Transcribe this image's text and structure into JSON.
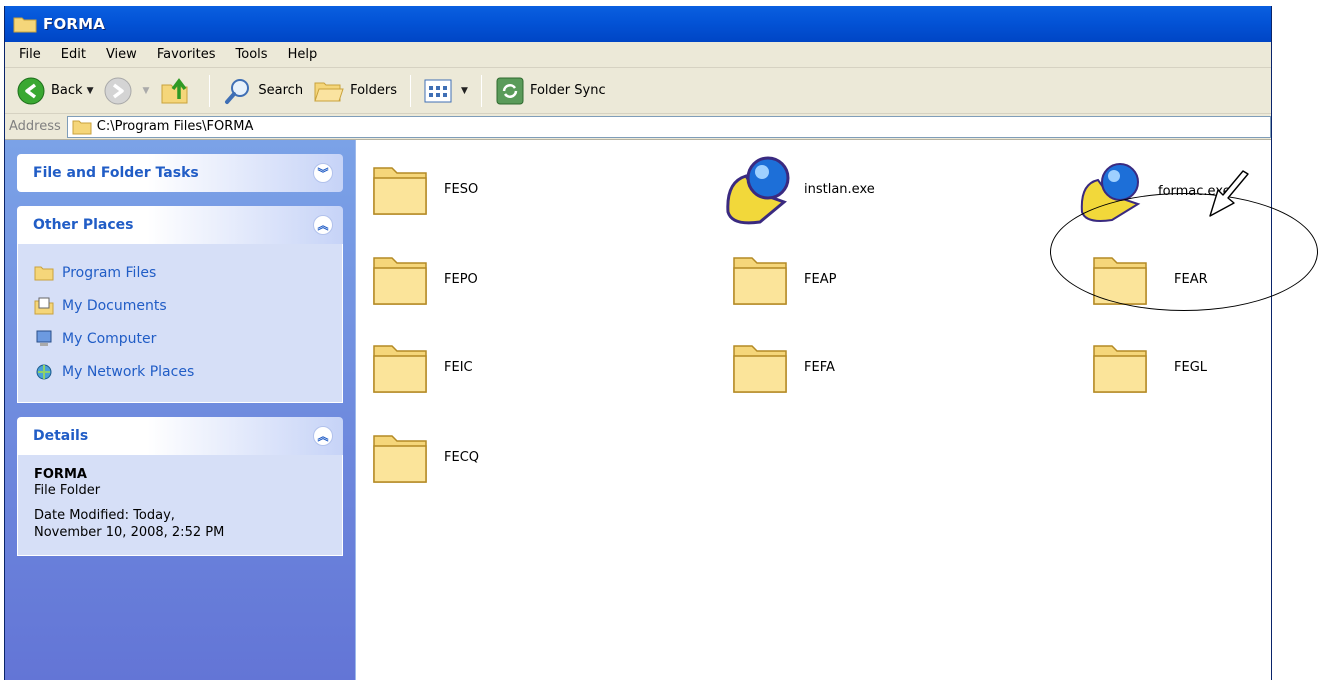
{
  "window": {
    "title": "FORMA"
  },
  "menu": [
    "File",
    "Edit",
    "View",
    "Favorites",
    "Tools",
    "Help"
  ],
  "toolbar": {
    "back_label": "Back",
    "search_label": "Search",
    "folders_label": "Folders",
    "sync_label": "Folder Sync"
  },
  "address": {
    "label": "Address",
    "value": "C:\\Program Files\\FORMA"
  },
  "taskpane": {
    "file_tasks_title": "File and Folder Tasks",
    "other_places_title": "Other Places",
    "places": [
      "Program Files",
      "My Documents",
      "My Computer",
      "My Network Places"
    ],
    "details_title": "Details",
    "details_name": "FORMA",
    "details_type": "File Folder",
    "details_modified_1": "Date Modified: Today,",
    "details_modified_2": "November 10, 2008, 2:52 PM"
  },
  "files": [
    "FESO",
    "instlan.exe",
    "formac.exe",
    "FEPO",
    "FEAP",
    "FEAR",
    "FEIC",
    "FEFA",
    "FEGL",
    "FECQ"
  ],
  "colors": {
    "title_bar": "#0353d6",
    "task_pane": "#7ba2e7",
    "panel_title": "#215dc6"
  }
}
